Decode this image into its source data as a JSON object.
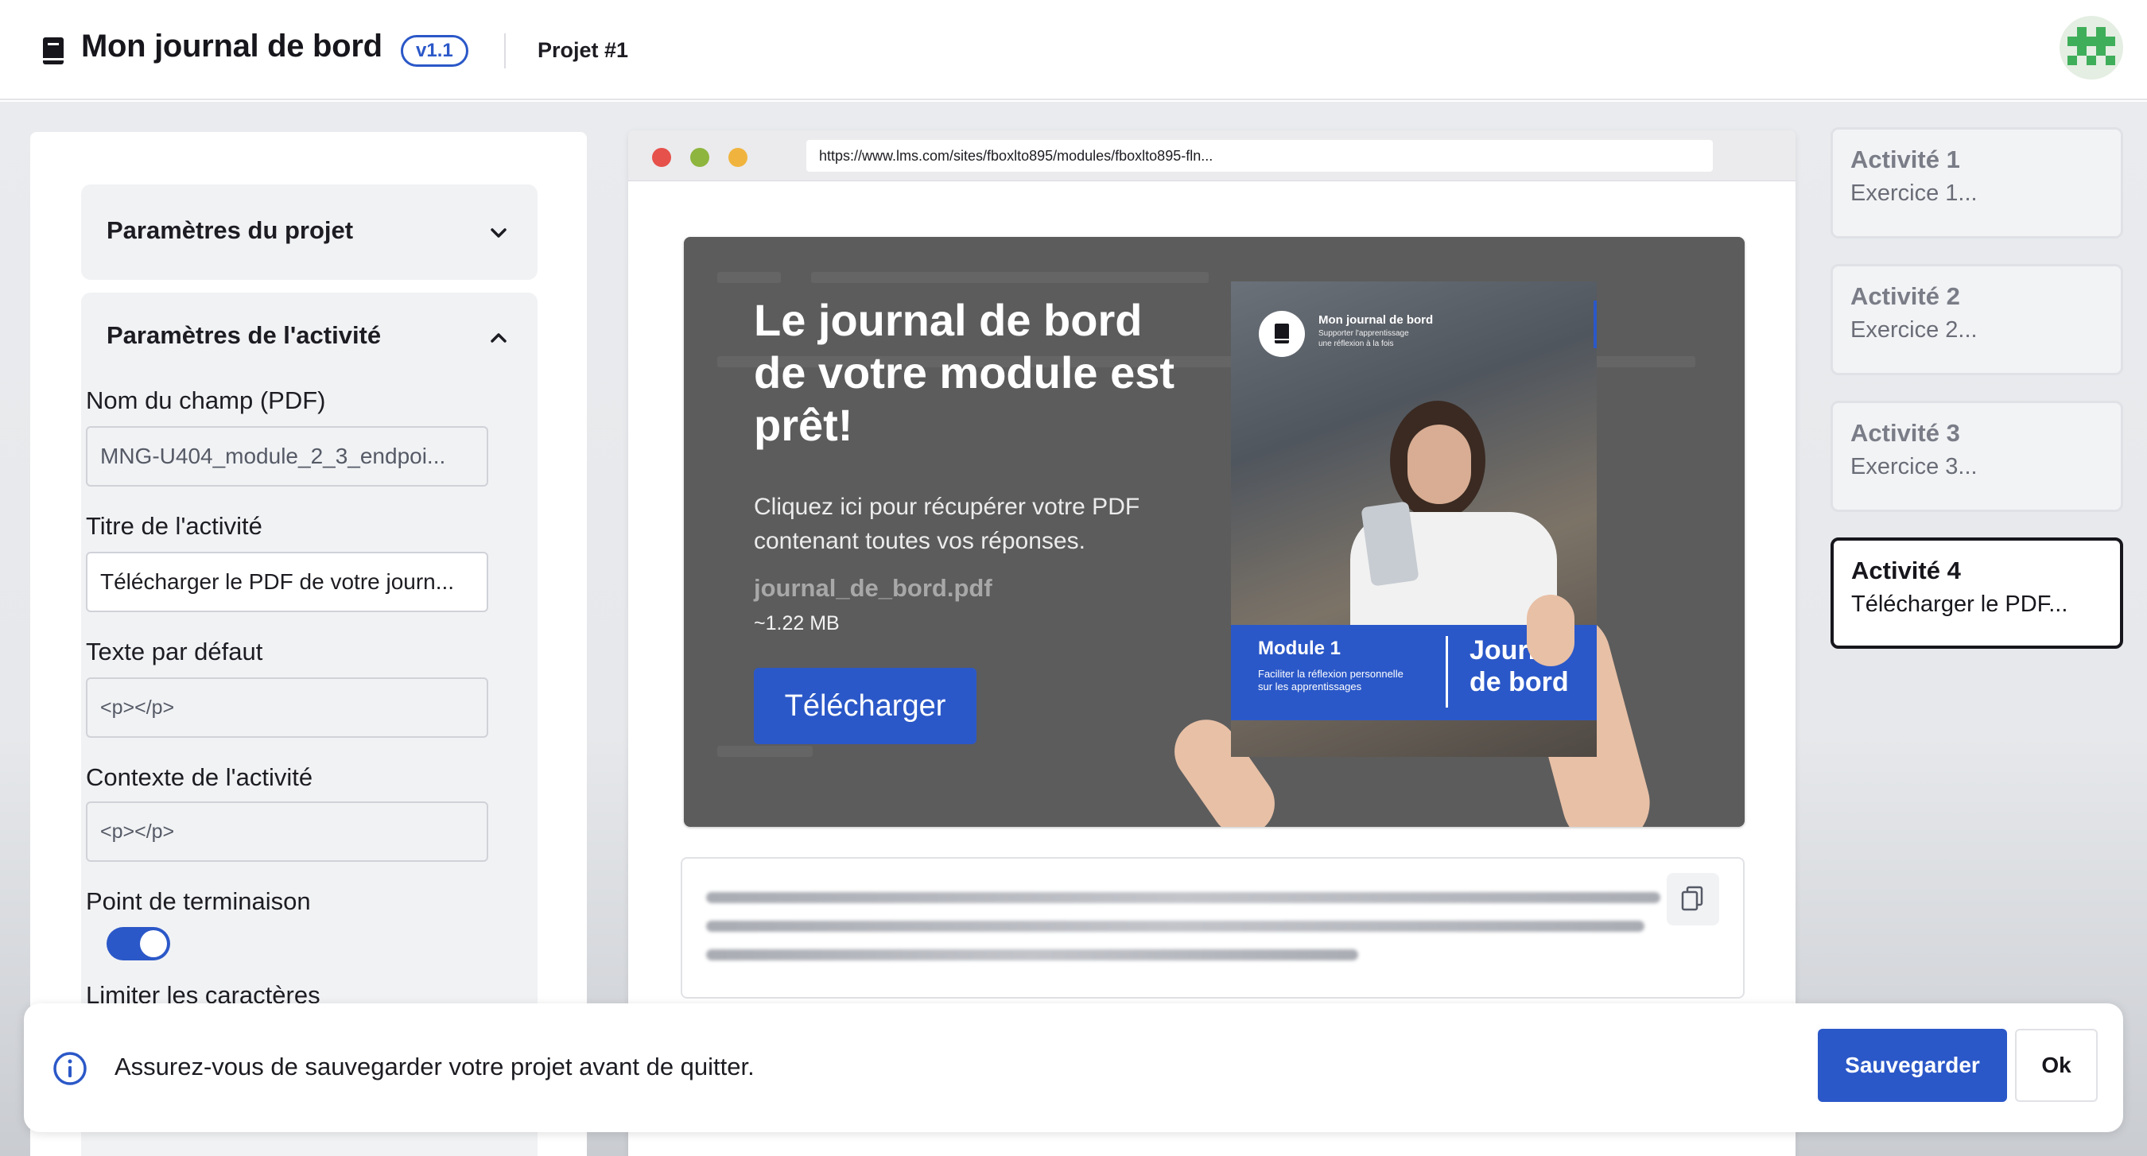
{
  "header": {
    "app_icon": "book-icon",
    "title": "Mon journal de bord",
    "version": "v1.1",
    "project": "Projet #1",
    "avatar_icon": "avatar-icon"
  },
  "left_panel": {
    "project_section": {
      "title": "Paramètres du projet",
      "state": "collapsed"
    },
    "activity_section": {
      "title": "Paramètres de l'activité",
      "state": "expanded"
    },
    "fields": {
      "pdf_name_label": "Nom du champ (PDF)",
      "pdf_name_value": "MNG-U404_module_2_3_endpoi...",
      "activity_title_label": "Titre de l'activité",
      "activity_title_value": "Télécharger le PDF de votre journ...",
      "default_text_label": "Texte par défaut",
      "default_text_value": "<p></p>",
      "context_label": "Contexte de l'activité",
      "context_value": "<p></p>",
      "endpoint_label": "Point de terminaison",
      "endpoint_enabled": true,
      "limit_chars_label": "Limiter les caractères"
    }
  },
  "preview": {
    "url": "https://www.lms.com/sites/fboxlto895/modules/fboxlto895-fln...",
    "hero": {
      "title": "Le journal de bord de votre module est prêt!",
      "description": "Cliquez ici pour récupérer votre PDF contenant toutes vos réponses.",
      "filename": "journal_de_bord.pdf",
      "filesize": "~1.22 MB",
      "download_label": "Télécharger",
      "cover": {
        "brand": "Mon journal de bord",
        "tagline_1": "Supporter l'apprentissage",
        "tagline_2": "une réflexion à la fois",
        "module": "Module 1",
        "module_desc_1": "Faciliter la réflexion personnelle",
        "module_desc_2": "sur les apprentissages",
        "journal_1": "Journal",
        "journal_2": "de bord"
      }
    },
    "copy_icon": "copy-icon"
  },
  "activities": [
    {
      "title": "Activité 1",
      "subtitle": "Exercice 1...",
      "active": false
    },
    {
      "title": "Activité 2",
      "subtitle": "Exercice 2...",
      "active": false
    },
    {
      "title": "Activité 3",
      "subtitle": "Exercice 3...",
      "active": false
    },
    {
      "title": "Activité 4",
      "subtitle": "Télécharger le PDF...",
      "active": true
    }
  ],
  "toast": {
    "icon": "info-icon",
    "message": "Assurez-vous de sauvegarder votre projet avant de quitter.",
    "save_label": "Sauvegarder",
    "ok_label": "Ok"
  },
  "colors": {
    "accent": "#2b58c8",
    "hero_bg": "#5c5c5c",
    "active_border": "#16161c"
  }
}
